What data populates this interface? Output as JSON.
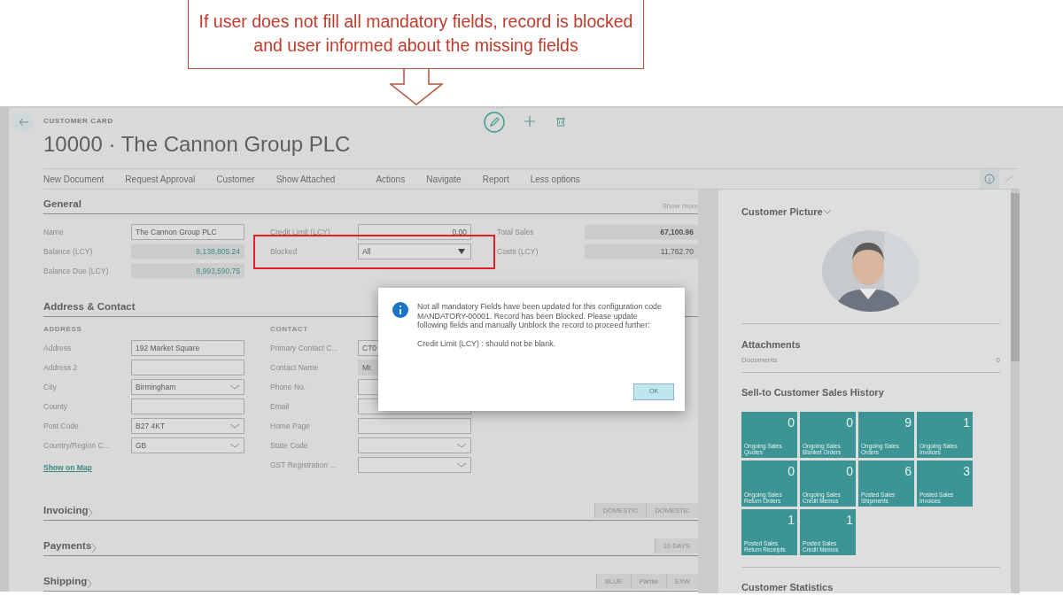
{
  "callout": {
    "text": "If user does not fill all mandatory fields, record is blocked and user informed about the missing fields"
  },
  "page": {
    "caption": "CUSTOMER CARD",
    "title": "10000 · The Cannon Group PLC"
  },
  "actions": [
    "New Document",
    "Request Approval",
    "Customer",
    "Show Attached",
    "Actions",
    "Navigate",
    "Report",
    "Less options"
  ],
  "general": {
    "title": "General",
    "show_more": "Show more",
    "columns": [
      [
        {
          "label": "Name",
          "value": "The Cannon Group PLC",
          "kind": "text",
          "highlighted": false
        },
        {
          "label": "Balance (LCY)",
          "value": "9,138,805.24",
          "kind": "flow",
          "highlighted": false
        },
        {
          "label": "Balance Due (LCY)",
          "value": "8,993,590.75",
          "kind": "flow",
          "highlighted": false
        }
      ],
      [
        {
          "label": "Credit Limit (LCY)",
          "value": "0.00",
          "kind": "amount",
          "highlighted": false
        },
        {
          "label": "Blocked",
          "value": "All",
          "kind": "option",
          "highlighted": true
        }
      ],
      [
        {
          "label": "Total Sales",
          "value": "67,100.96",
          "kind": "total",
          "highlighted": false
        },
        {
          "label": "Costs (LCY)",
          "value": "11,762.70",
          "kind": "figure",
          "highlighted": false
        }
      ]
    ]
  },
  "address_contact": {
    "title": "Address & Contact",
    "groups": [
      {
        "heading": "ADDRESS",
        "fields": [
          {
            "label": "Address",
            "value": "192 Market Square",
            "kind": "text"
          },
          {
            "label": "Address 2",
            "kind": "text"
          },
          {
            "label": "City",
            "value": "Birmingham",
            "kind": "combo"
          },
          {
            "label": "County",
            "kind": "text"
          },
          {
            "label": "Post Code",
            "value": "B27 4KT",
            "kind": "combo"
          },
          {
            "label": "Country/Region C...",
            "value": "GB",
            "kind": "combo"
          }
        ],
        "link": "Show on Map"
      },
      {
        "heading": "CONTACT",
        "fields": [
          {
            "label": "Primary Contact C...",
            "value": "CT0",
            "kind": "text"
          },
          {
            "label": "Contact Name",
            "value": "Mr.",
            "kind": "readonly"
          },
          {
            "label": "Phone No.",
            "kind": "text"
          },
          {
            "label": "Email",
            "kind": "text"
          },
          {
            "label": "Home Page",
            "kind": "text"
          },
          {
            "label": "State Code",
            "kind": "combo"
          },
          {
            "label": "GST Registration ...",
            "kind": "combo"
          }
        ]
      }
    ]
  },
  "collapsed_sections": [
    {
      "title": "Invoicing",
      "chips": [
        "DOMESTIC",
        "DOMESTIC"
      ]
    },
    {
      "title": "Payments",
      "chips": [
        "10 DAYS"
      ]
    },
    {
      "title": "Shipping",
      "chips": [
        "BLUE",
        "Partial",
        "EXW"
      ]
    }
  ],
  "factbox": {
    "picture_title": "Customer Picture",
    "attachments": {
      "title": "Attachments",
      "label": "Documents",
      "count": "0"
    },
    "history_title": "Sell-to Customer Sales History",
    "tiles": [
      {
        "count": "0",
        "label": "Ongoing Sales Quotes"
      },
      {
        "count": "0",
        "label": "Ongoing Sales Blanket Orders"
      },
      {
        "count": "9",
        "label": "Ongoing Sales Orders"
      },
      {
        "count": "1",
        "label": "Ongoing Sales Invoices"
      },
      {
        "count": "0",
        "label": "Ongoing Sales Return Orders"
      },
      {
        "count": "0",
        "label": "Ongoing Sales Credit Memos"
      },
      {
        "count": "6",
        "label": "Posted Sales Shipments"
      },
      {
        "count": "3",
        "label": "Posted Sales Invoices"
      },
      {
        "count": "1",
        "label": "Posted Sales Return Receipts"
      },
      {
        "count": "1",
        "label": "Posted Sales Credit Memos"
      }
    ],
    "statistics_title": "Customer Statistics"
  },
  "dialog": {
    "message": "Not all mandatory Fields have been updated for this configuration code MANDATORY-00001. Record has been Blocked. Please update following fields and manually Unblock the record to proceed further:",
    "detail": "Credit Limit (LCY) : should not be blank.",
    "button": "OK"
  }
}
